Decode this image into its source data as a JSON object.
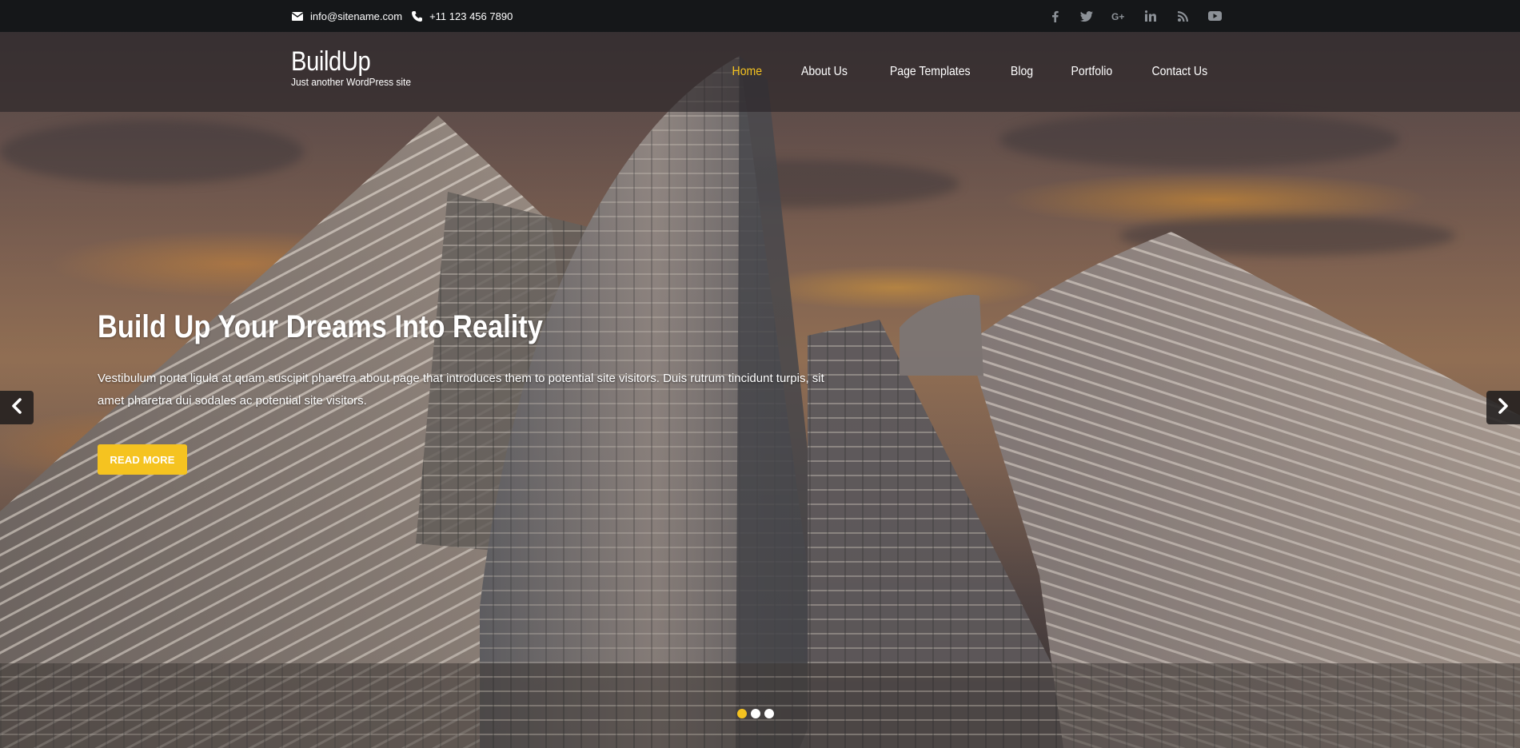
{
  "topbar": {
    "email": "info@sitename.com",
    "phone": "+11 123 456 7890",
    "social": [
      {
        "icon": "facebook-icon",
        "glyph": "f"
      },
      {
        "icon": "twitter-icon",
        "glyph": "t"
      },
      {
        "icon": "google-plus-icon",
        "glyph": "G+"
      },
      {
        "icon": "linkedin-icon",
        "glyph": "in"
      },
      {
        "icon": "rss-icon",
        "glyph": "rss"
      },
      {
        "icon": "youtube-icon",
        "glyph": "yt"
      }
    ]
  },
  "header": {
    "site_title": "BuildUp",
    "tagline": "Just another WordPress site",
    "nav": [
      {
        "label": "Home",
        "active": true
      },
      {
        "label": "About Us",
        "active": false
      },
      {
        "label": "Page Templates",
        "active": false
      },
      {
        "label": "Blog",
        "active": false
      },
      {
        "label": "Portfolio",
        "active": false
      },
      {
        "label": "Contact Us",
        "active": false
      }
    ]
  },
  "slider": {
    "heading": "Build Up Your Dreams Into Reality",
    "text": "Vestibulum porta ligula at quam suscipit pharetra about page that introduces them to potential site visitors. Duis rutrum tincidunt turpis, sit amet pharetra dui sodales ac potential site visitors.",
    "button_label": "READ MORE",
    "prev_icon": "chevron-left-icon",
    "next_icon": "chevron-right-icon",
    "slide_count": 3,
    "active_slide": 1
  },
  "colors": {
    "accent": "#f5c320",
    "topbar_bg": "#151719",
    "social_icon": "#8c9197"
  }
}
